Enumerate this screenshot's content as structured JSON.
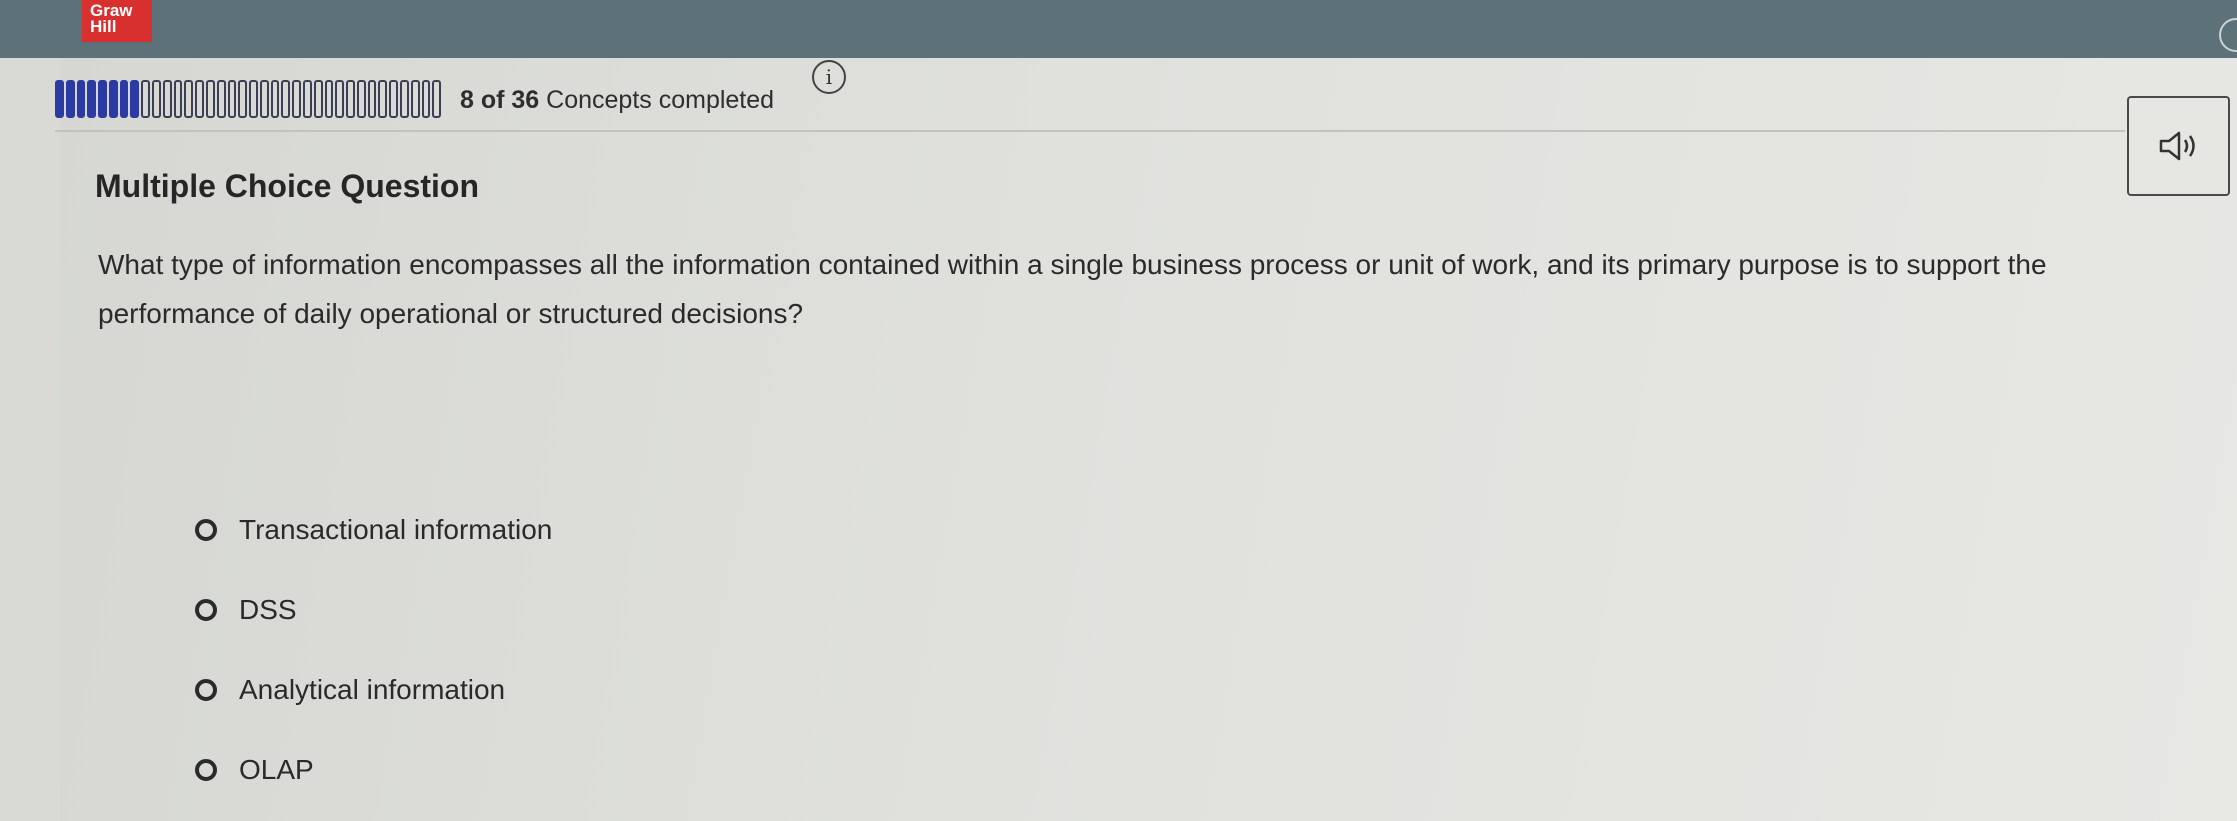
{
  "brand": {
    "logo_line1": "Graw",
    "logo_line2": "Hill"
  },
  "progress": {
    "completed": 8,
    "total": 36,
    "label_count": "8 of 36",
    "label_suffix": " Concepts completed"
  },
  "question": {
    "type_label": "Multiple Choice Question",
    "text": "What type of information encompasses all the information contained within a single business process or unit of work, and its primary purpose is to support the performance of daily operational or structured decisions?",
    "choices": [
      {
        "label": "Transactional information"
      },
      {
        "label": "DSS"
      },
      {
        "label": "Analytical information"
      },
      {
        "label": "OLAP"
      }
    ]
  },
  "icons": {
    "info": "info-icon",
    "audio": "speaker-icon"
  },
  "colors": {
    "topbar": "#5d7178",
    "logo": "#d8302f",
    "progress_done": "#2c3aa4"
  }
}
